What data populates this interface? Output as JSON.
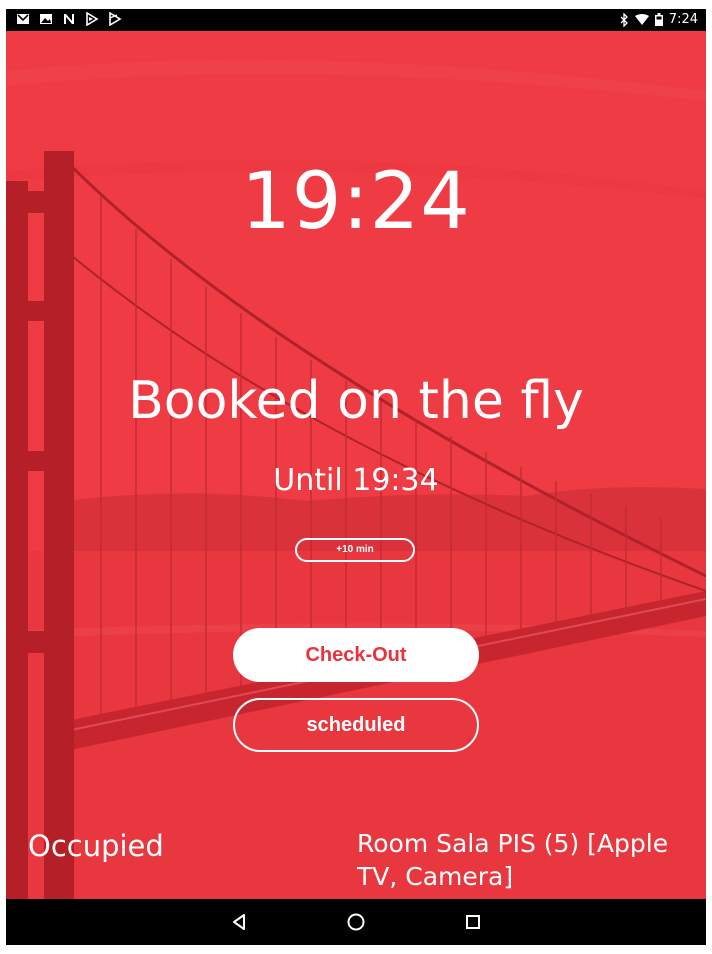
{
  "status_bar": {
    "left_icons": [
      "gmail-icon",
      "image-icon",
      "n-app-icon",
      "play-store-icon",
      "play-movies-icon"
    ],
    "right_icons": [
      "bluetooth-icon",
      "wifi-icon",
      "battery-icon"
    ],
    "time": "7:24"
  },
  "room_panel": {
    "clock": "19:24",
    "booking_title": "Booked on the fly",
    "until": "Until 19:34",
    "extend_label": "+10 min",
    "checkout_label": "Check-Out",
    "scheduled_label": "scheduled",
    "status": "Occupied",
    "room_name": "Room Sala PIS (5) [Apple TV, Camera]"
  },
  "nav_bar": {
    "back_icon": "back-triangle-icon",
    "home_icon": "home-circle-icon",
    "recents_icon": "recents-square-icon"
  },
  "colors": {
    "accent_red": "#ef3b44",
    "button_text_red": "#e8333d",
    "text_white": "#ffffff"
  }
}
